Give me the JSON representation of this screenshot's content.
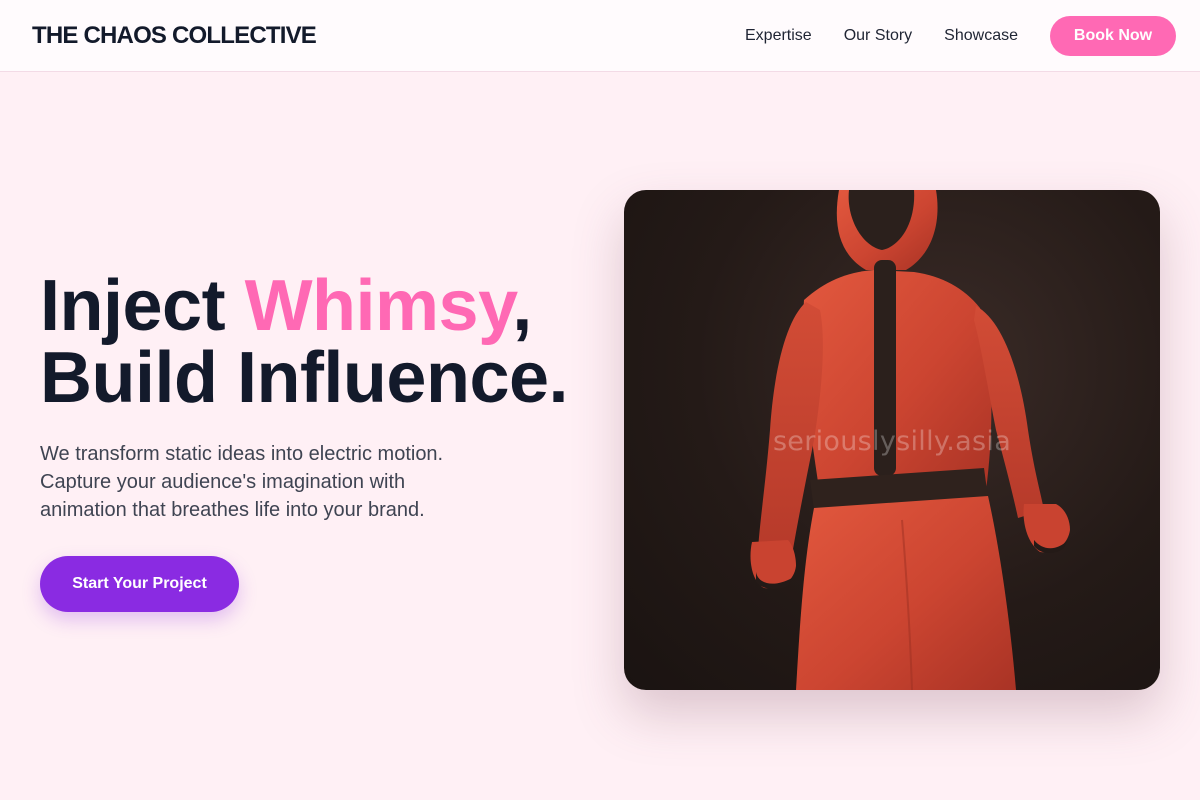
{
  "header": {
    "brand": "THE CHAOS COLLECTIVE",
    "nav": [
      "Expertise",
      "Our Story",
      "Showcase"
    ],
    "cta_label": "Book Now"
  },
  "hero": {
    "headline_part1": "Inject ",
    "headline_accent": "Whimsy",
    "headline_part2": ",",
    "headline_line2": "Build Influence.",
    "subtext": "We transform static ideas into electric motion. Capture your audience's imagination with animation that breathes life into your brand.",
    "cta_label": "Start Your Project",
    "image_watermark": "seriouslysilly.asia"
  },
  "colors": {
    "page_background": "#fff0f5",
    "accent_pink": "#ff69b4",
    "accent_purple": "#8a2be2",
    "text_dark": "#131a2b"
  },
  "icons": {
    "hero_image": "red-hooded-jumpsuit-figure"
  }
}
